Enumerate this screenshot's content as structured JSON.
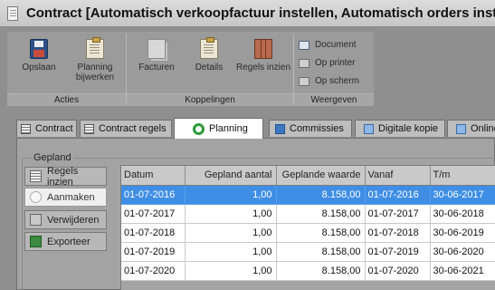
{
  "window": {
    "title": "Contract [Automatisch verkoopfactuur instellen, Automatisch orders instellen, B"
  },
  "ribbon": {
    "groups": [
      {
        "label": "Acties",
        "buttons": [
          "Opslaan",
          "Planning bijwerken"
        ]
      },
      {
        "label": "Koppelingen",
        "buttons": [
          "Facturen",
          "Details",
          "Regels inzien"
        ]
      },
      {
        "label": "Weergeven",
        "buttons": [
          "Document",
          "Op printer",
          "Op scherm"
        ]
      }
    ],
    "actions": {
      "save": "Opslaan",
      "planning_line1": "Planning",
      "planning_line2": "bijwerken"
    },
    "links": {
      "invoices": "Facturen",
      "details": "Details",
      "lines": "Regels inzien"
    },
    "view": {
      "document": "Document",
      "printer": "Op printer",
      "screen": "Op scherm"
    }
  },
  "tabs": [
    {
      "label": "Contract",
      "icon": "grid-icon"
    },
    {
      "label": "Contract regels",
      "icon": "grid-icon"
    },
    {
      "label": "Planning",
      "icon": "cycle-icon",
      "active": true
    },
    {
      "label": "Commissies",
      "icon": "commission-icon"
    },
    {
      "label": "Digitale kopie",
      "icon": "copy-icon"
    },
    {
      "label": "Online",
      "icon": "copy-icon"
    }
  ],
  "planning": {
    "fieldset_label": "Gepland",
    "buttons": {
      "view_lines": "Regels inzien",
      "create": "Aanmaken",
      "delete": "Verwijderen",
      "export": "Exporteer"
    },
    "columns": [
      "Datum",
      "Gepland aantal",
      "Geplande waarde",
      "Vanaf",
      "T/m"
    ],
    "rows": [
      [
        "01-07-2016",
        "1,00",
        "8.158,00",
        "01-07-2016",
        "30-06-2017"
      ],
      [
        "01-07-2017",
        "1,00",
        "8.158,00",
        "01-07-2017",
        "30-06-2018"
      ],
      [
        "01-07-2018",
        "1,00",
        "8.158,00",
        "01-07-2018",
        "30-06-2019"
      ],
      [
        "01-07-2019",
        "1,00",
        "8.158,00",
        "01-07-2019",
        "30-06-2020"
      ],
      [
        "01-07-2020",
        "1,00",
        "8.158,00",
        "01-07-2020",
        "30-06-2021"
      ]
    ],
    "selected_row": 0
  },
  "colors": {
    "selection": "#3f8ee6",
    "active_tab": "#ffffff",
    "panel": "#a3a3a3"
  }
}
